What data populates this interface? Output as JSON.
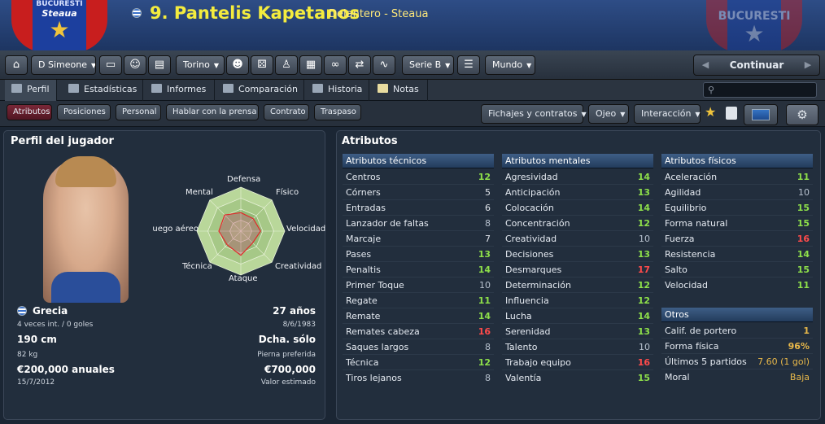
{
  "header": {
    "crest_left": {
      "arc": "BUCURESTI",
      "team": "Steaua",
      "sub": "BUCURESTI"
    },
    "crest_right": {
      "arc": "BUCURESTI"
    },
    "player_title": "9. Pantelis Kapetanos",
    "subtitle": "Delantero - Steaua"
  },
  "toolbar": {
    "manager": "D Simeone",
    "league_city": "Torino",
    "division": "Serie B",
    "world": "Mundo",
    "continue": "Continuar"
  },
  "tabs": [
    {
      "label": "Perfil",
      "active": true
    },
    {
      "label": "Estadísticas"
    },
    {
      "label": "Informes"
    },
    {
      "label": "Comparación"
    },
    {
      "label": "Historia"
    },
    {
      "label": "Notas"
    }
  ],
  "search": {
    "placeholder": "⚲"
  },
  "subtabs": [
    {
      "label": "Atributos",
      "active": true
    },
    {
      "label": "Posiciones"
    },
    {
      "label": "Personal"
    },
    {
      "label": "Hablar con la prensa"
    },
    {
      "label": "Contrato"
    },
    {
      "label": "Traspaso"
    }
  ],
  "actions": {
    "transfers": "Fichajes y contratos",
    "eye": "Ojeo",
    "interaction": "Interacción"
  },
  "profile": {
    "title": "Perfil del jugador",
    "nationality": "Grecia",
    "caps": "4 veces int. / 0 goles",
    "height": "190 cm",
    "weight": "82 kg",
    "wage": "€200,000 anuales",
    "contract_end": "15/7/2012",
    "age": "27 años",
    "dob": "8/6/1983",
    "foot": "Dcha. sólo",
    "foot_label": "Pierna preferida",
    "value": "€700,000",
    "value_label": "Valor estimado"
  },
  "radar": {
    "labels": [
      "Defensa",
      "Físico",
      "Velocidad",
      "Creatividad",
      "Ataque",
      "Técnica",
      "Juego aéreo",
      "Mental"
    ],
    "values": [
      0.42,
      0.4,
      0.45,
      0.38,
      0.55,
      0.44,
      0.5,
      0.52
    ]
  },
  "attributes": {
    "title": "Atributos",
    "technical": {
      "header": "Atributos técnicos",
      "rows": [
        {
          "name": "Centros",
          "value": "12"
        },
        {
          "name": "Córners",
          "value": "5"
        },
        {
          "name": "Entradas",
          "value": "6"
        },
        {
          "name": "Lanzador de faltas",
          "value": "8"
        },
        {
          "name": "Marcaje",
          "value": "7"
        },
        {
          "name": "Pases",
          "value": "13"
        },
        {
          "name": "Penaltis",
          "value": "14"
        },
        {
          "name": "Primer Toque",
          "value": "10"
        },
        {
          "name": "Regate",
          "value": "11"
        },
        {
          "name": "Remate",
          "value": "14"
        },
        {
          "name": "Remates cabeza",
          "value": "16"
        },
        {
          "name": "Saques largos",
          "value": "8"
        },
        {
          "name": "Técnica",
          "value": "12"
        },
        {
          "name": "Tiros lejanos",
          "value": "8"
        }
      ]
    },
    "mental": {
      "header": "Atributos mentales",
      "rows": [
        {
          "name": "Agresividad",
          "value": "14"
        },
        {
          "name": "Anticipación",
          "value": "13"
        },
        {
          "name": "Colocación",
          "value": "14"
        },
        {
          "name": "Concentración",
          "value": "12"
        },
        {
          "name": "Creatividad",
          "value": "10"
        },
        {
          "name": "Decisiones",
          "value": "13"
        },
        {
          "name": "Desmarques",
          "value": "17"
        },
        {
          "name": "Determinación",
          "value": "12"
        },
        {
          "name": "Influencia",
          "value": "12"
        },
        {
          "name": "Lucha",
          "value": "14"
        },
        {
          "name": "Serenidad",
          "value": "13"
        },
        {
          "name": "Talento",
          "value": "10"
        },
        {
          "name": "Trabajo equipo",
          "value": "16"
        },
        {
          "name": "Valentía",
          "value": "15"
        }
      ]
    },
    "physical": {
      "header": "Atributos físicos",
      "rows": [
        {
          "name": "Aceleración",
          "value": "11"
        },
        {
          "name": "Agilidad",
          "value": "10"
        },
        {
          "name": "Equilibrio",
          "value": "15"
        },
        {
          "name": "Forma natural",
          "value": "15"
        },
        {
          "name": "Fuerza",
          "value": "16"
        },
        {
          "name": "Resistencia",
          "value": "14"
        },
        {
          "name": "Salto",
          "value": "15"
        },
        {
          "name": "Velocidad",
          "value": "11"
        }
      ]
    },
    "other": {
      "header": "Otros",
      "rows": [
        {
          "name": "Calif. de portero",
          "value": "1"
        },
        {
          "name": "Forma física",
          "value": "96%"
        },
        {
          "name": "Últimos 5 partidos",
          "value": "7.60 (1 gol)"
        },
        {
          "name": "Moral",
          "value": "Baja"
        }
      ]
    }
  },
  "colors": {
    "high": "#8ee04a",
    "mid": "#b8c2cf",
    "low": "#e0e4ea",
    "top": "#ff4b4b",
    "gold": "#e8b84a"
  }
}
